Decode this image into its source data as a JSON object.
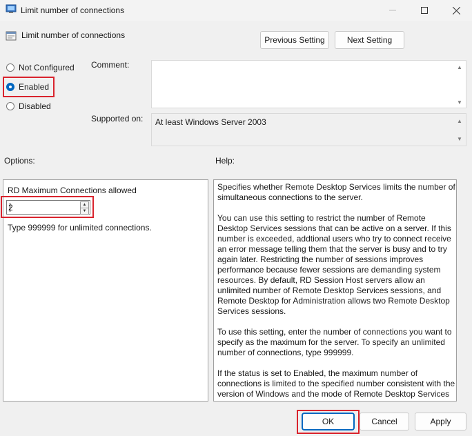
{
  "window": {
    "title": "Limit number of connections",
    "min_icon": "minimize-icon",
    "max_icon": "maximize-icon",
    "close_icon": "close-icon"
  },
  "header": {
    "policy_name": "Limit number of connections",
    "prev_label": "Previous Setting",
    "next_label": "Next Setting"
  },
  "state": {
    "options": [
      {
        "label": "Not Configured",
        "checked": false
      },
      {
        "label": "Enabled",
        "checked": true
      },
      {
        "label": "Disabled",
        "checked": false
      }
    ]
  },
  "comment": {
    "label": "Comment:",
    "value": ""
  },
  "supported": {
    "label": "Supported on:",
    "value": "At least Windows Server 2003"
  },
  "options_section": {
    "label": "Options:",
    "field_label": "RD Maximum Connections allowed",
    "field_value": "2",
    "hint": "Type 999999 for unlimited connections."
  },
  "help": {
    "label": "Help:",
    "paragraphs": [
      "Specifies whether Remote Desktop Services limits the number of simultaneous connections to the server.",
      "You can use this setting to restrict the number of Remote Desktop Services sessions that can be active on a server. If this number is exceeded, addtional users who try to connect receive an error message telling them that the server is busy and to try again later. Restricting the number of sessions improves performance because fewer sessions are demanding system resources. By default, RD Session Host servers allow an unlimited number of Remote Desktop Services sessions, and Remote Desktop for Administration allows two Remote Desktop Services sessions.",
      "To use this setting, enter the number of connections you want to specify as the maximum for the server. To specify an unlimited number of connections, type 999999.",
      "If the status is set to Enabled, the maximum number of connections is limited to the specified number consistent with the version of Windows and the mode of Remote Desktop Services running on the server."
    ]
  },
  "footer": {
    "ok_label": "OK",
    "cancel_label": "Cancel",
    "apply_label": "Apply"
  },
  "colors": {
    "accent": "#0067c0",
    "highlight": "#d9232d"
  }
}
